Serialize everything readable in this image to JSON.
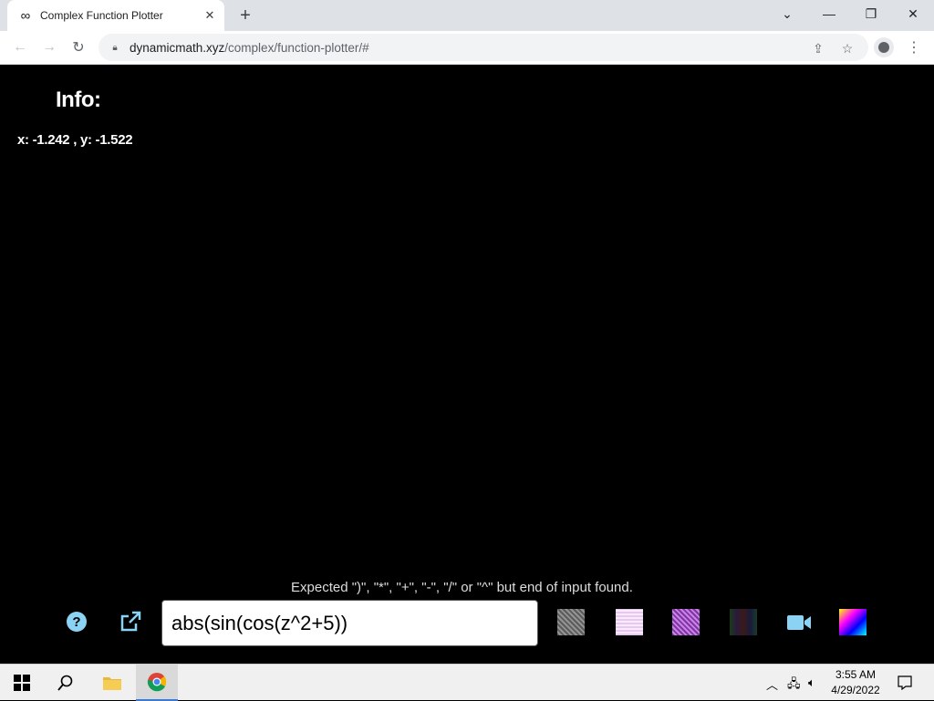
{
  "browser": {
    "tab_title": "Complex Function Plotter",
    "tab_favicon": "infinity-icon",
    "url_host": "dynamicmath.xyz",
    "url_path": "/complex/function-plotter/#"
  },
  "page": {
    "info_title": "Info:",
    "coords": "x: -1.242 , y: -1.522",
    "error_message": "Expected \")\", \"*\", \"+\", \"-\", \"/\" or \"^\" but end of input found.",
    "expression": "abs(sin(cos(z^2+5))",
    "help_label": "?"
  },
  "taskbar": {
    "time": "3:55 AM",
    "date": "4/29/2022"
  }
}
